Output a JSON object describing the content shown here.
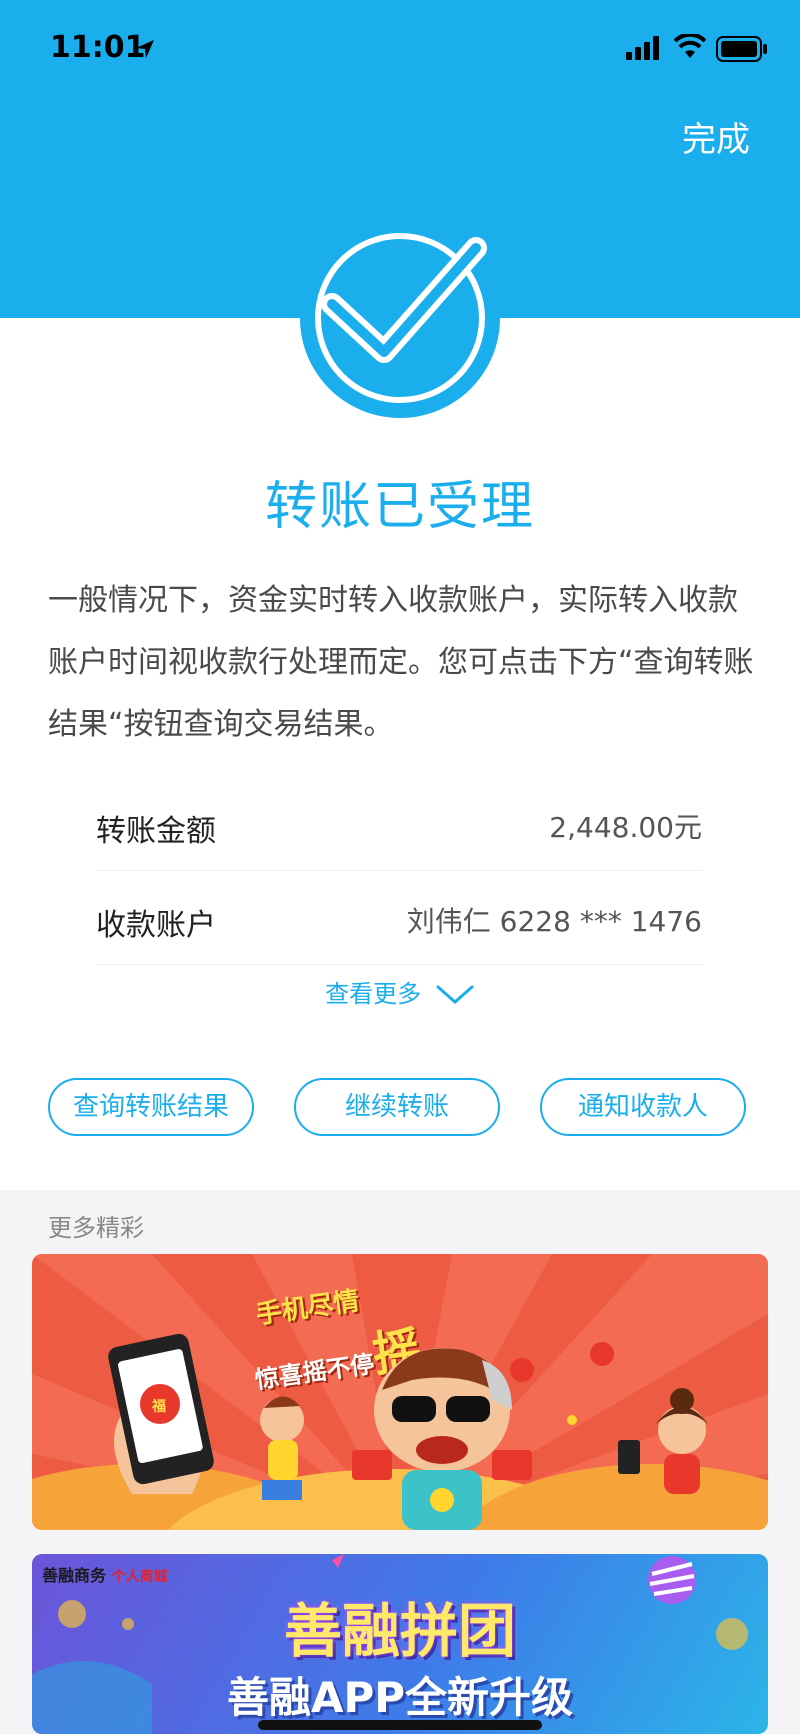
{
  "status_bar": {
    "time": "11:01"
  },
  "header": {
    "done_label": "完成"
  },
  "result": {
    "title": "转账已受理",
    "description": "一般情况下，资金实时转入收款账户，实际转入收款账户时间视收款行处理而定。您可点击下方“查询转账结果“按钮查询交易结果。"
  },
  "details": [
    {
      "label": "转账金额",
      "value": "2,448.00元"
    },
    {
      "label": "收款账户",
      "value": "刘伟仁 6228 *** 1476"
    }
  ],
  "more_link": {
    "label": "查看更多"
  },
  "actions": [
    {
      "label": "查询转账结果"
    },
    {
      "label": "继续转账"
    },
    {
      "label": "通知收款人"
    }
  ],
  "promo": {
    "heading": "更多精彩",
    "banner1": {
      "line1": "手机尽情",
      "line2": "惊喜摇不停",
      "big": "摇",
      "badge": "福"
    },
    "banner2": {
      "brand": "善融商务",
      "brand_tag": "个人商城",
      "title": "善融拼团",
      "subtitle": "善融APP全新升级"
    }
  },
  "colors": {
    "primary": "#1aaeed",
    "banner1_bg": "#ee5b43"
  }
}
